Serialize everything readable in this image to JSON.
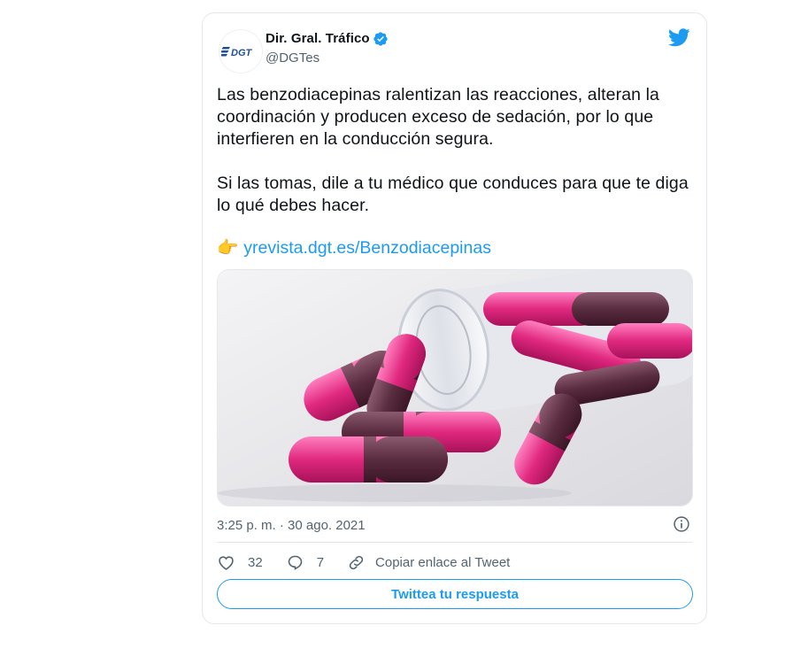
{
  "author": {
    "display_name": "Dir. Gral. Tráfico",
    "handle": "@DGTes",
    "avatar_text": "DGT",
    "verified": true
  },
  "tweet": {
    "paragraphs": [
      "Las benzodiacepinas ralentizan las reacciones, alteran la coordinación y producen exceso de sedación, por lo que interfieren en la conducción segura.",
      "Si las tomas, dile a tu médico que conduces para que te diga lo qué debes hacer."
    ],
    "link_emoji": "👉",
    "link_text": "yrevista.dgt.es/Benzodiacepinas",
    "timestamp": "3:25 p. m. · 30 ago. 2021"
  },
  "actions": {
    "likes": "32",
    "replies": "7",
    "copy_link": "Copiar enlace al Tweet"
  },
  "reply_button": "Twittea tu respuesta",
  "colors": {
    "accent": "#1d9bf0",
    "text": "#0f1419",
    "muted": "#536471",
    "border": "#e3e8ec"
  }
}
